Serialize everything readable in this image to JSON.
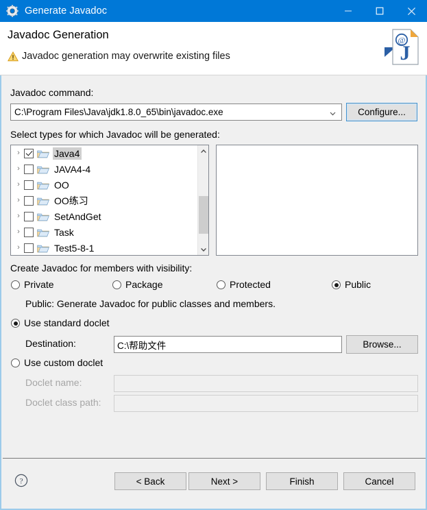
{
  "window": {
    "title": "Generate Javadoc",
    "icon": "gear-icon",
    "minimize_label": "",
    "maximize_label": "",
    "close_label": "✕",
    "titlebar_color": "#0078d7"
  },
  "header": {
    "title": "Javadoc Generation",
    "subtitle": "Javadoc generation may overwrite existing files",
    "warning_icon": "warning-triangle-icon",
    "banner_icon": "javadoc-page-icon",
    "warning_color": "#f0ad20"
  },
  "command": {
    "label": "Javadoc command:",
    "value": "C:\\Program Files\\Java\\jdk1.8.0_65\\bin\\javadoc.exe",
    "dropdown_icon": "chevron-down-icon",
    "configure_label": "Configure...",
    "focus_color": "#3c93d5"
  },
  "types": {
    "label": "Select types for which Javadoc will be generated:",
    "tree": [
      {
        "name": "Java4",
        "checked": true,
        "selected": true,
        "expander": "›",
        "icon": "folder-icon"
      },
      {
        "name": "JAVA4-4",
        "checked": false,
        "selected": false,
        "expander": "›",
        "icon": "folder-icon"
      },
      {
        "name": "OO",
        "checked": false,
        "selected": false,
        "expander": "›",
        "icon": "folder-icon"
      },
      {
        "name": "OO练习",
        "checked": false,
        "selected": false,
        "expander": "›",
        "icon": "folder-icon"
      },
      {
        "name": "SetAndGet",
        "checked": false,
        "selected": false,
        "expander": "›",
        "icon": "folder-icon"
      },
      {
        "name": "Task",
        "checked": false,
        "selected": false,
        "expander": "›",
        "icon": "folder-icon"
      },
      {
        "name": "Test5-8-1",
        "checked": false,
        "selected": false,
        "expander": "›",
        "icon": "folder-icon"
      }
    ],
    "scroll_up_icon": "chevron-up-icon",
    "scroll_down_icon": "chevron-down-icon",
    "right_panel_items": []
  },
  "visibility": {
    "label": "Create Javadoc for members with visibility:",
    "options": [
      {
        "label": "Private",
        "selected": false
      },
      {
        "label": "Package",
        "selected": false
      },
      {
        "label": "Protected",
        "selected": false
      },
      {
        "label": "Public",
        "selected": true
      }
    ],
    "description": "Public: Generate Javadoc for public classes and members."
  },
  "doclet": {
    "standard_label": "Use standard doclet",
    "standard_selected": true,
    "destination_label": "Destination:",
    "destination_value": "C:\\帮助文件",
    "browse_label": "Browse...",
    "custom_label": "Use custom doclet",
    "custom_selected": false,
    "doclet_name_label": "Doclet name:",
    "doclet_name_value": "",
    "doclet_class_path_label": "Doclet class path:",
    "doclet_class_path_value": ""
  },
  "footer": {
    "help_icon": "help-question-icon",
    "back_label": "< Back",
    "next_label": "Next >",
    "finish_label": "Finish",
    "cancel_label": "Cancel"
  }
}
